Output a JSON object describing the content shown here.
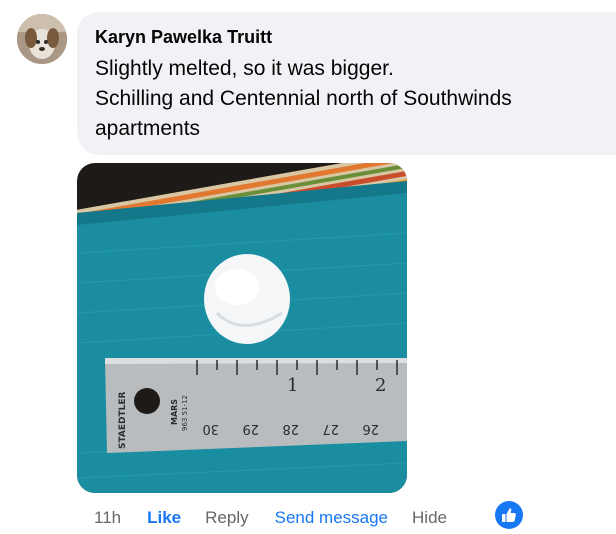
{
  "comment": {
    "author": "Karyn Pawelka Truitt",
    "lines": [
      "Slightly melted, so it was bigger.",
      "Schilling and Centennial north of Southwinds",
      "apartments"
    ]
  },
  "photo": {
    "ruler_brand": "STAEDTLER",
    "ruler_model": "MARS",
    "ruler_code": "963 51-12",
    "inch_marks": [
      "1",
      "2"
    ],
    "cm_marks": [
      "30",
      "29",
      "28",
      "27",
      "26"
    ]
  },
  "actions": {
    "time": "11h",
    "like": "Like",
    "reply": "Reply",
    "send_message": "Send message",
    "hide": "Hide"
  },
  "colors": {
    "link_blue": "#1877f2",
    "bubble_bg": "#f0f2f5",
    "meta_gray": "#65676b"
  }
}
